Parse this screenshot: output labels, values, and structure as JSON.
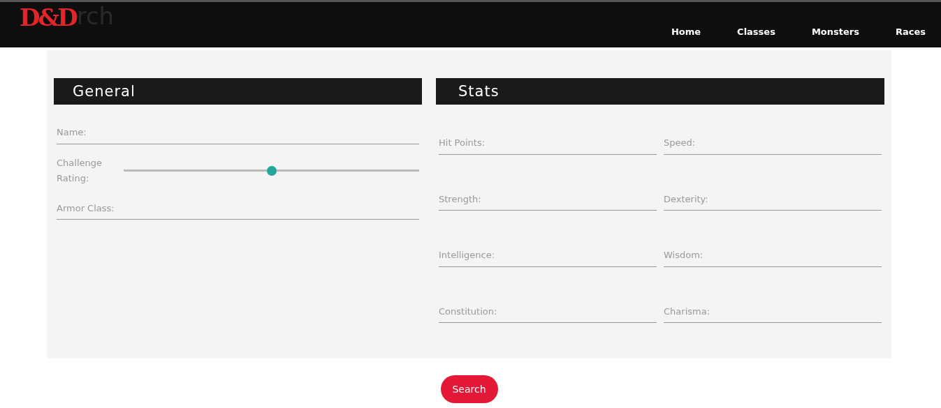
{
  "navbar": {
    "logo_text": "D&D",
    "title": "rch",
    "links": [
      {
        "label": "Home"
      },
      {
        "label": "Classes"
      },
      {
        "label": "Monsters"
      },
      {
        "label": "Races"
      }
    ]
  },
  "general": {
    "heading": "General",
    "name_field": {
      "placeholder": "Name:"
    },
    "challenge_rating": {
      "label": "Challenge Rating:",
      "level": 0.5
    },
    "armor_field": {
      "placeholder": "Armor Class:"
    }
  },
  "stats": {
    "heading": "Stats",
    "fields": [
      {
        "placeholder": "Hit Points:"
      },
      {
        "placeholder": "Speed:"
      },
      {
        "placeholder": "Strength:"
      },
      {
        "placeholder": "Dexterity:"
      },
      {
        "placeholder": "Intelligence:"
      },
      {
        "placeholder": "Wisdom:"
      },
      {
        "placeholder": "Constitution:"
      },
      {
        "placeholder": "Charisma:"
      }
    ]
  },
  "search_button": "Search"
}
